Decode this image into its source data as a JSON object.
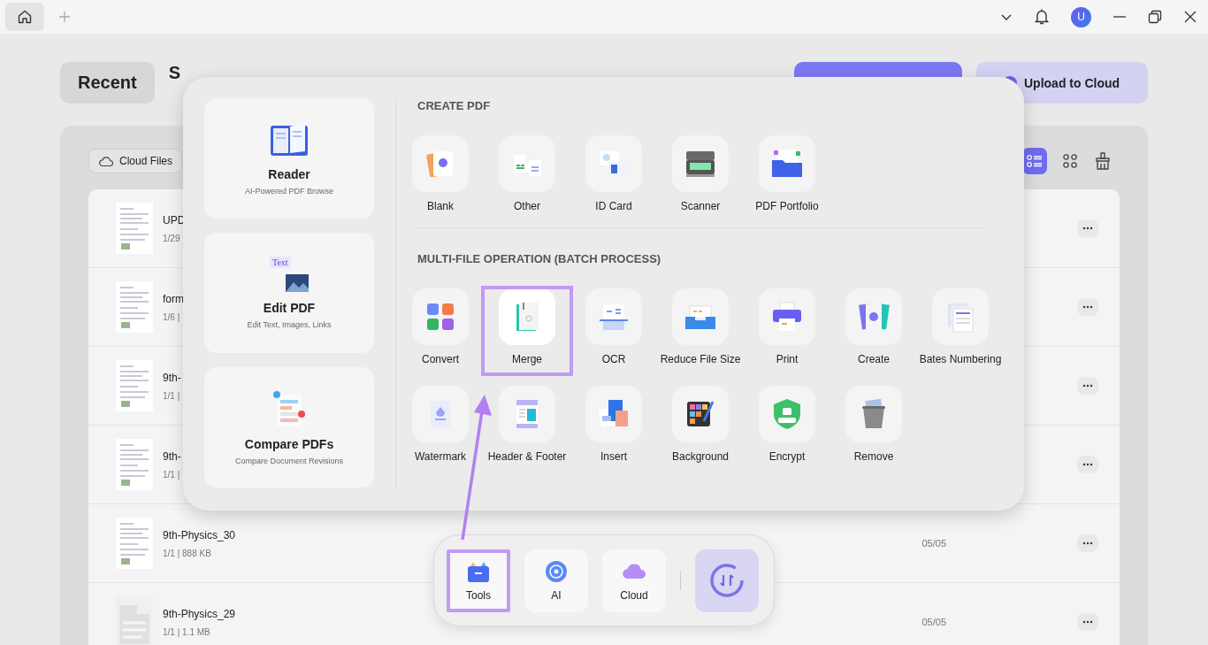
{
  "title_bar": {
    "avatar": "U"
  },
  "header": {
    "tabs": [
      {
        "label": "Recent",
        "selected": true
      },
      {
        "label": "S",
        "selected": false
      }
    ],
    "upload_button": "Upload to Cloud"
  },
  "toolbar": {
    "cloud_files": "Cloud Files",
    "views": [
      {
        "kind": "list",
        "selected": true
      },
      {
        "kind": "grid",
        "selected": false
      }
    ]
  },
  "files": [
    {
      "name": "UPD",
      "info": "1/29",
      "kind": "page"
    },
    {
      "name": "form",
      "info": "1/6 |",
      "kind": "page"
    },
    {
      "name": "9th-",
      "info": "1/1 |",
      "kind": "page"
    },
    {
      "name": "9th-",
      "info": "1/1 |",
      "kind": "page"
    },
    {
      "name": "9th-Physics_30",
      "info": "1/1 | 888 KB",
      "date": "05/05",
      "kind": "page"
    },
    {
      "name": "9th-Physics_29",
      "info": "1/1 | 1.1 MB",
      "date": "05/05",
      "kind": "placeholder"
    }
  ],
  "tools_popup": {
    "modes": [
      {
        "kind": "reader",
        "title": "Reader",
        "subtitle": "AI-Powered PDF Browse"
      },
      {
        "kind": "edit",
        "title": "Edit PDF",
        "subtitle": "Edit Text, Images, Links",
        "icon_text": "Text"
      },
      {
        "kind": "compare",
        "title": "Compare PDFs",
        "subtitle": "Compare Document Revisions"
      }
    ],
    "sections": [
      {
        "title": "CREATE PDF",
        "tools": [
          {
            "kind": "blank",
            "label": "Blank",
            "highlighted": false
          },
          {
            "kind": "other",
            "label": "Other",
            "highlighted": false
          },
          {
            "kind": "idcard",
            "label": "ID Card",
            "highlighted": false
          },
          {
            "kind": "scanner",
            "label": "Scanner",
            "highlighted": false
          },
          {
            "kind": "portfolio",
            "label": "PDF Portfolio",
            "highlighted": false
          }
        ]
      },
      {
        "title": "MULTI-FILE OPERATION (BATCH PROCESS)",
        "tools": [
          {
            "kind": "convert",
            "label": "Convert",
            "highlighted": false
          },
          {
            "kind": "merge",
            "label": "Merge",
            "highlighted": true
          },
          {
            "kind": "ocr",
            "label": "OCR",
            "highlighted": false
          },
          {
            "kind": "compress",
            "label": "Reduce File Size",
            "highlighted": false
          },
          {
            "kind": "print",
            "label": "Print",
            "highlighted": false
          },
          {
            "kind": "create",
            "label": "Create",
            "highlighted": false
          },
          {
            "kind": "bates",
            "label": "Bates Numbering",
            "highlighted": false
          },
          {
            "kind": "watermark",
            "label": "Watermark",
            "highlighted": false
          },
          {
            "kind": "headerfooter",
            "label": "Header & Footer",
            "highlighted": false
          },
          {
            "kind": "insert",
            "label": "Insert",
            "highlighted": false
          },
          {
            "kind": "background",
            "label": "Background",
            "highlighted": false
          },
          {
            "kind": "encrypt",
            "label": "Encrypt",
            "highlighted": false
          },
          {
            "kind": "remove",
            "label": "Remove",
            "highlighted": false
          }
        ]
      }
    ]
  },
  "dock": {
    "items": [
      {
        "kind": "tools",
        "label": "Tools",
        "highlighted": true
      },
      {
        "kind": "ai",
        "label": "AI",
        "highlighted": false
      },
      {
        "kind": "cloud",
        "label": "Cloud",
        "highlighted": false
      }
    ]
  }
}
